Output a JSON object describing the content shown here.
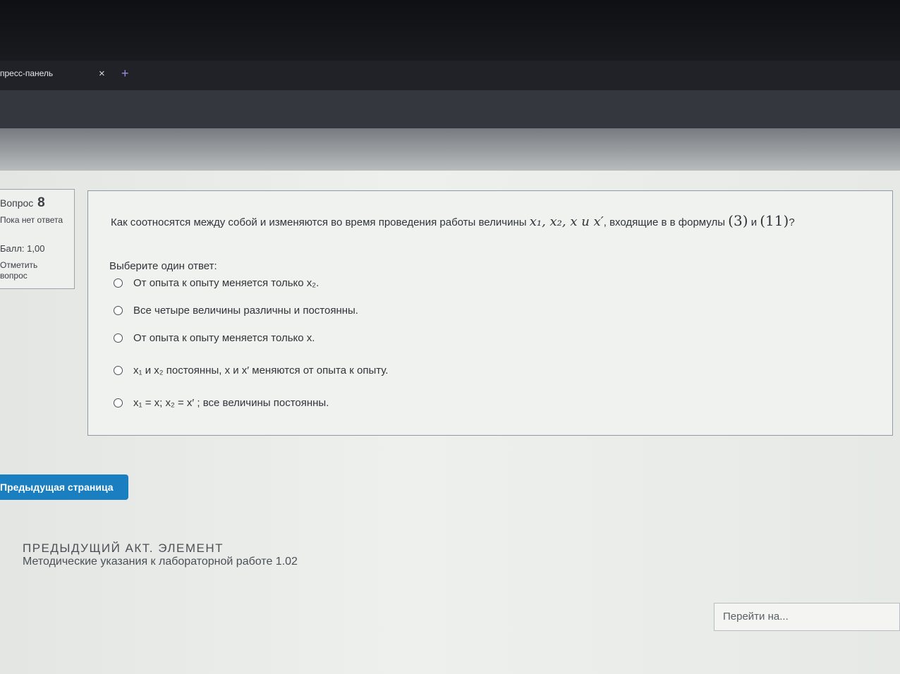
{
  "browser": {
    "tab_title": "пресс-панель",
    "close_glyph": "×",
    "new_tab_glyph": "+"
  },
  "question_info": {
    "label": "Вопрос",
    "number": "8",
    "status": "Пока нет ответа",
    "grade": "Балл: 1,00",
    "flag": "Отметить вопрос"
  },
  "question": {
    "text_before": "Как соотносятся между собой  и изменяются во время проведения работы  величины",
    "vars": "x₁, x₂, x и x′",
    "text_after": ", входящие в в формулы",
    "formula_a": "(3)",
    "joiner": "и",
    "formula_b": "(11)",
    "end": "?",
    "prompt": "Выберите один ответ:"
  },
  "options": [
    {
      "text": "От опыта к опыту меняется только x₂."
    },
    {
      "text": "Все четыре величины различны и постоянны."
    },
    {
      "text": "От опыта к опыту меняется только x."
    },
    {
      "text": "x₁ и x₂ постоянны, x и x′  меняются от опыта к опыту."
    },
    {
      "text": "x₁ = x; x₂ = x′ ; все величины постоянны."
    }
  ],
  "nav": {
    "prev_button": "Предыдущая страница",
    "prev_activity_heading": "ПРЕДЫДУЩИЙ АКТ. ЭЛЕМЕНТ",
    "prev_activity_link": "Методические указания к лабораторной работе 1.02",
    "jump_placeholder": "Перейти на..."
  },
  "colors": {
    "accent": "#1a7fc1",
    "tab_underline": "#3c3566"
  }
}
